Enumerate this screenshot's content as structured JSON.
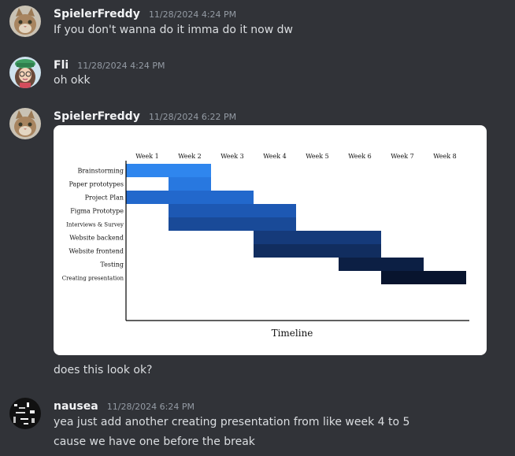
{
  "messages": [
    {
      "username": "SpielerFreddy",
      "timestamp": "11/28/2024 4:24 PM",
      "text": "If you don't wanna do it imma do it now dw",
      "avatar_icon": "cat-avatar-icon"
    },
    {
      "username": "Fli",
      "timestamp": "11/28/2024 4:24 PM",
      "text": "oh okk",
      "avatar_icon": "girl-avatar-icon"
    },
    {
      "username": "SpielerFreddy",
      "timestamp": "11/28/2024 6:22 PM",
      "text": "does this look ok?",
      "avatar_icon": "cat-avatar-icon"
    },
    {
      "username": "nausea",
      "timestamp": "11/28/2024 6:24 PM",
      "lines": [
        "yea just add another creating presentation from like week 4 to 5",
        "cause we have one  before the break"
      ],
      "avatar_icon": "glitch-avatar-icon"
    }
  ],
  "chart_data": {
    "type": "gantt",
    "xlabel": "Timeline",
    "categories": [
      "Week 1",
      "Week 2",
      "Week 3",
      "Week 4",
      "Week 5",
      "Week 6",
      "Week 7",
      "Week 8"
    ],
    "tasks": [
      {
        "name": "Brainstorming",
        "start": 1,
        "end": 2,
        "color": "#2f86ee"
      },
      {
        "name": "Paper prototypes",
        "start": 2,
        "end": 2,
        "color": "#2878e0"
      },
      {
        "name": "Project Plan",
        "start": 1,
        "end": 3,
        "color": "#2268cc"
      },
      {
        "name": "Figma Prototype",
        "start": 2,
        "end": 4,
        "color": "#1d58b3"
      },
      {
        "name": "Interviews & Survey",
        "start": 2,
        "end": 4,
        "color": "#194a98"
      },
      {
        "name": "Website backend",
        "start": 4,
        "end": 6,
        "color": "#153a7a"
      },
      {
        "name": "Website frontend",
        "start": 4,
        "end": 6,
        "color": "#112d5f"
      },
      {
        "name": "Testing",
        "start": 6,
        "end": 7,
        "color": "#0c1f44"
      },
      {
        "name": "Creating presentation",
        "start": 7,
        "end": 8,
        "color": "#08142e"
      }
    ]
  }
}
